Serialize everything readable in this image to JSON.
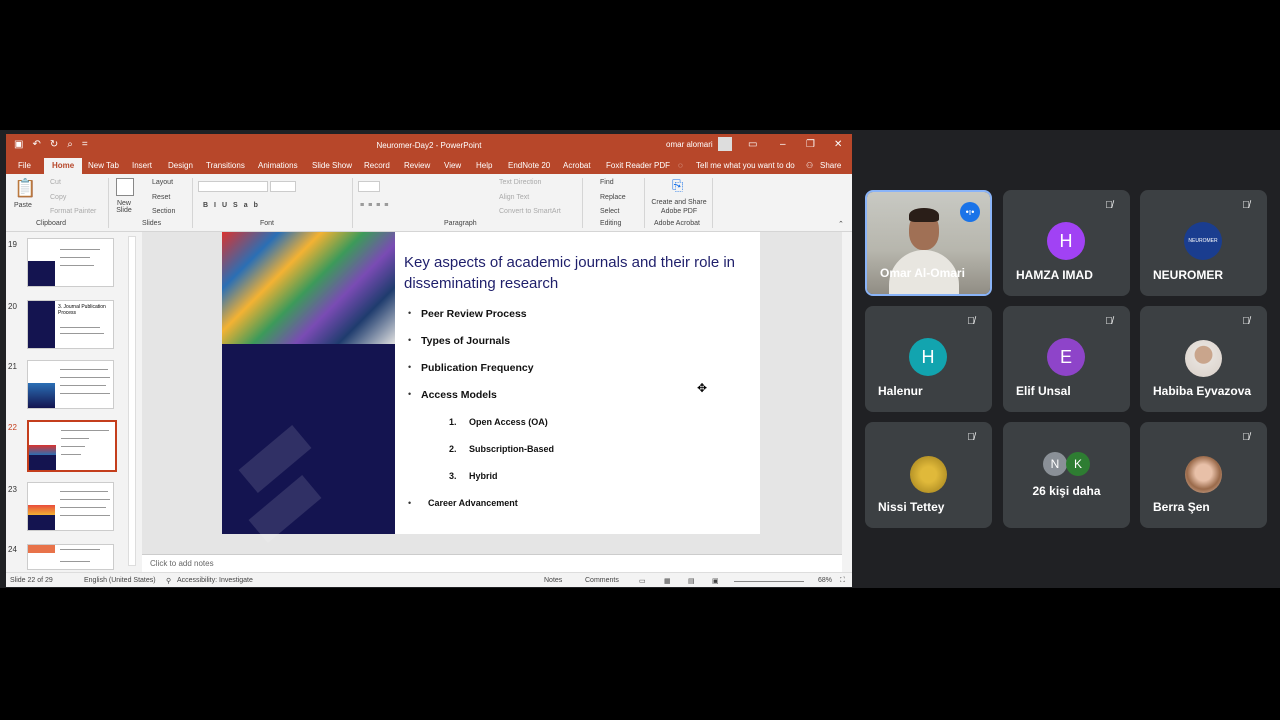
{
  "window": {
    "title": "Neuromer-Day2  -  PowerPoint",
    "user": "omar alomari"
  },
  "menu": [
    "File",
    "Home",
    "New Tab",
    "Insert",
    "Design",
    "Transitions",
    "Animations",
    "Slide Show",
    "Record",
    "Review",
    "View",
    "Help",
    "EndNote 20",
    "Acrobat",
    "Foxit Reader PDF"
  ],
  "tell_me": "Tell me what you want to do",
  "share": "Share",
  "ribbon": {
    "paste": "Paste",
    "cut": "Cut",
    "copy": "Copy",
    "format_painter": "Format Painter",
    "clipboard": "Clipboard",
    "new_slide": "New Slide",
    "layout": "Layout",
    "reset": "Reset",
    "section": "Section",
    "slides": "Slides",
    "font": "Font",
    "paragraph": "Paragraph",
    "text_direction": "Text Direction",
    "align_text": "Align Text",
    "convert_smartart": "Convert to SmartArt",
    "find": "Find",
    "replace": "Replace",
    "select": "Select",
    "editing": "Editing",
    "create_share": "Create and Share Adobe PDF",
    "adobe_acrobat": "Adobe Acrobat"
  },
  "thumbs": [
    {
      "num": "19",
      "title": ""
    },
    {
      "num": "20",
      "title": "3. Journal Publication Process"
    },
    {
      "num": "21",
      "title": ""
    },
    {
      "num": "22",
      "title": ""
    },
    {
      "num": "23",
      "title": ""
    },
    {
      "num": "24",
      "title": ""
    }
  ],
  "slide": {
    "title": "Key aspects of academic journals and their role in disseminating research",
    "bullets": [
      "Peer Review Process",
      "Types of Journals",
      "Publication Frequency",
      "Access Models"
    ],
    "sub_bullets": [
      {
        "n": "1.",
        "t": "Open Access (OA)"
      },
      {
        "n": "2.",
        "t": "Subscription-Based"
      },
      {
        "n": "3.",
        "t": "Hybrid"
      }
    ],
    "last": "Career Advancement"
  },
  "notes_placeholder": "Click to add notes",
  "status": {
    "slide": "Slide 22 of 29",
    "lang": "English (United States)",
    "access": "Accessibility: Investigate",
    "notes": "Notes",
    "comments": "Comments",
    "zoom": "68%"
  },
  "participants": [
    {
      "name": "Omar Al-Omari",
      "initial": "",
      "color": "",
      "type": "camera"
    },
    {
      "name": "HAMZA IMAD",
      "initial": "H",
      "color": "#a142f4"
    },
    {
      "name": "NEUROMER",
      "initial": "",
      "color": "#1a3d8f",
      "type": "logo"
    },
    {
      "name": "Halenur",
      "initial": "H",
      "color": "#12a4af"
    },
    {
      "name": "Elif Unsal",
      "initial": "E",
      "color": "#8e44c9"
    },
    {
      "name": "Habiba Eyvazova",
      "initial": "",
      "color": "#d9cfc7",
      "type": "photo"
    },
    {
      "name": "Nissi Tettey",
      "initial": "",
      "color": "#c9a227",
      "type": "photo"
    },
    {
      "name": "26 kişi daha",
      "initial": "",
      "color": "",
      "type": "more"
    },
    {
      "name": "Berra Şen",
      "initial": "",
      "color": "#e3c4b2",
      "type": "photo"
    }
  ],
  "more_avatars": [
    "N",
    "K"
  ]
}
